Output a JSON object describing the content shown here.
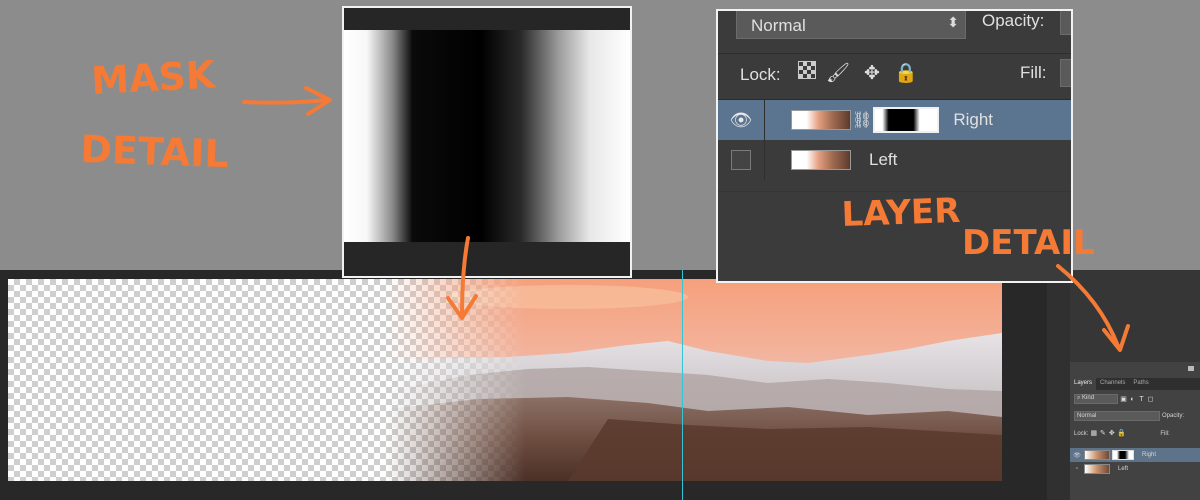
{
  "annotations": {
    "mask_detail": [
      "MASK",
      "DETAIL"
    ],
    "layer_detail": [
      "LAYER",
      "DETAIL"
    ]
  },
  "layer_detail_panel": {
    "blend_mode": "Normal",
    "opacity_label": "Opacity:",
    "lock_label": "Lock:",
    "fill_label": "Fill:",
    "layers": [
      {
        "name": "Right",
        "selected": true,
        "visible": true,
        "has_mask": true
      },
      {
        "name": "Left",
        "selected": false,
        "visible": false,
        "has_mask": false
      }
    ]
  },
  "layers_panel": {
    "tabs": [
      "Layers",
      "Channels",
      "Paths"
    ],
    "filter_kind": "Kind",
    "blend_mode": "Normal",
    "opacity_label": "Opacity:",
    "lock_label": "Lock:",
    "fill_label": "Fill:",
    "layers": [
      {
        "name": "Right",
        "selected": true
      },
      {
        "name": "Left",
        "selected": false
      }
    ]
  },
  "colors": {
    "annotation": "#f47a35",
    "guide": "#35c4d6",
    "selected_layer": "#5b7590"
  }
}
